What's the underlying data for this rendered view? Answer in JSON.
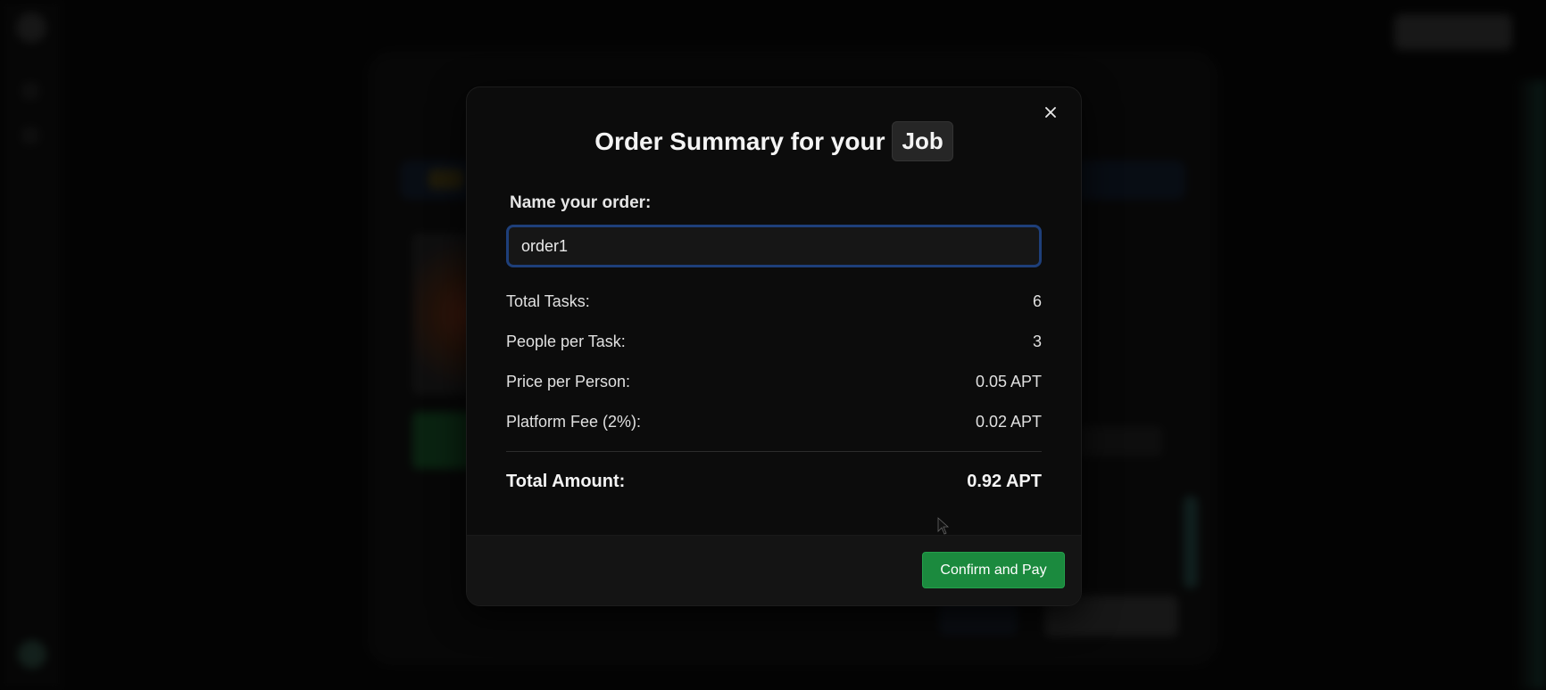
{
  "modal": {
    "title_prefix": "Order Summary for your",
    "title_chip": "Job",
    "name_label": "Name your order:",
    "order_name_value": "order1",
    "rows": [
      {
        "label": "Total Tasks:",
        "value": "6"
      },
      {
        "label": "People per Task:",
        "value": "3"
      },
      {
        "label": "Price per Person:",
        "value": "0.05 APT"
      },
      {
        "label": "Platform Fee (2%):",
        "value": "0.02 APT"
      }
    ],
    "total_label": "Total Amount:",
    "total_value": "0.92 APT",
    "confirm_label": "Confirm and Pay",
    "close_icon": "close-icon"
  },
  "colors": {
    "modal_bg": "#0c0c0c",
    "footer_bg": "#141414",
    "input_border": "#1e3f7a",
    "confirm_bg": "#1b8a3e",
    "text": "#f4f4f4"
  }
}
